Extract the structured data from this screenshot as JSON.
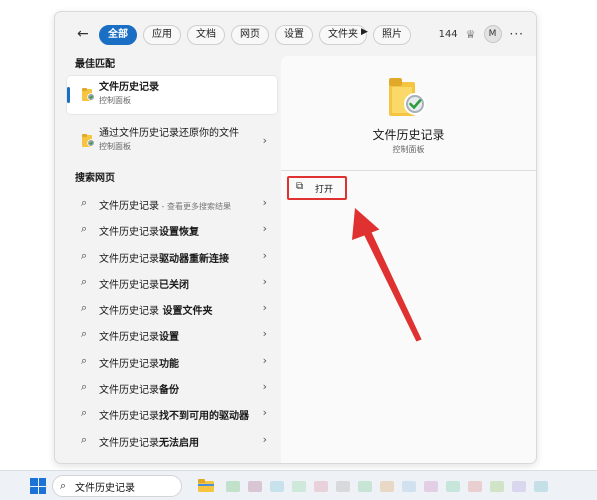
{
  "filter": {
    "back_glyph": "←",
    "chips": [
      {
        "label": "全部",
        "active": true
      },
      {
        "label": "应用",
        "active": false
      },
      {
        "label": "文档",
        "active": false
      },
      {
        "label": "网页",
        "active": false
      },
      {
        "label": "设置",
        "active": false
      },
      {
        "label": "文件夹",
        "active": false
      },
      {
        "label": "照片",
        "active": false
      }
    ],
    "play_glyph": "▶",
    "points": "144",
    "trophy_glyph": "♕",
    "avatar": "M",
    "more_glyph": "···"
  },
  "left": {
    "best_title": "最佳匹配",
    "best": {
      "title": "文件历史记录",
      "subtitle": "控制面板"
    },
    "app": {
      "title": "通过文件历史记录还原你的文件",
      "subtitle": "控制面板"
    },
    "web_title": "搜索网页",
    "web_items": [
      {
        "base": "文件历史记录",
        "bold": "",
        "hint": " - 查看更多搜索结果"
      },
      {
        "base": "文件历史记录",
        "bold": "设置恢复",
        "hint": ""
      },
      {
        "base": "文件历史记录",
        "bold": "驱动器重新连接",
        "hint": ""
      },
      {
        "base": "文件历史记录",
        "bold": "已关闭",
        "hint": ""
      },
      {
        "base": "文件历史记录",
        "bold": " 设置文件夹",
        "hint": ""
      },
      {
        "base": "文件历史记录",
        "bold": "设置",
        "hint": ""
      },
      {
        "base": "文件历史记录",
        "bold": "功能",
        "hint": ""
      },
      {
        "base": "文件历史记录",
        "bold": "备份",
        "hint": ""
      },
      {
        "base": "文件历史记录",
        "bold": "找不到可用的驱动器",
        "hint": ""
      },
      {
        "base": "文件历史记录",
        "bold": "无法启用",
        "hint": ""
      }
    ],
    "chevron_glyph": "›",
    "magnifier_glyph": "⌕"
  },
  "right": {
    "title": "文件历史记录",
    "subtitle": "控制面板",
    "open_label": "打开",
    "open_glyph": "⧉"
  },
  "taskbar": {
    "search_value": "文件历史记录",
    "search_glyph": "⌕"
  },
  "colors": {
    "accent": "#1a6ec4",
    "highlight": "#e03131",
    "folder": "#f5c542"
  }
}
